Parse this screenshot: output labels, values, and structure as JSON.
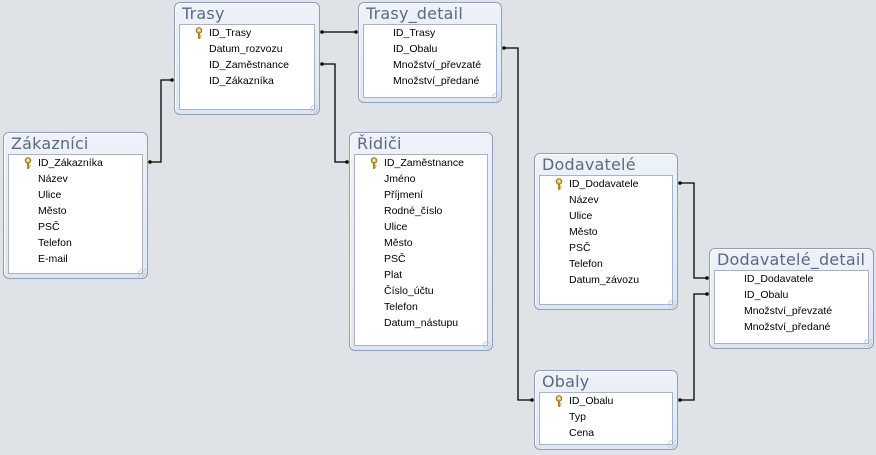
{
  "tables": [
    {
      "id": "trasy",
      "title": "Trasy",
      "fields": [
        {
          "name": "ID_Trasy",
          "key": true
        },
        {
          "name": "Datum_rozvozu",
          "key": false
        },
        {
          "name": "ID_Zaměstnance",
          "key": false
        },
        {
          "name": "ID_Zákazníka",
          "key": false
        }
      ]
    },
    {
      "id": "trasy_detail",
      "title": "Trasy_detail",
      "fields": [
        {
          "name": "ID_Trasy",
          "key": false
        },
        {
          "name": "ID_Obalu",
          "key": false
        },
        {
          "name": "Množství_převzaté",
          "key": false
        },
        {
          "name": "Množství_předané",
          "key": false
        }
      ]
    },
    {
      "id": "zakaznici",
      "title": "Zákazníci",
      "fields": [
        {
          "name": "ID_Zákazníka",
          "key": true
        },
        {
          "name": "Název",
          "key": false
        },
        {
          "name": "Ulice",
          "key": false
        },
        {
          "name": "Město",
          "key": false
        },
        {
          "name": "PSČ",
          "key": false
        },
        {
          "name": "Telefon",
          "key": false
        },
        {
          "name": "E-mail",
          "key": false
        }
      ]
    },
    {
      "id": "ridici",
      "title": "Řidiči",
      "fields": [
        {
          "name": "ID_Zaměstnance",
          "key": true
        },
        {
          "name": "Jméno",
          "key": false
        },
        {
          "name": "Příjmení",
          "key": false
        },
        {
          "name": "Rodné_číslo",
          "key": false
        },
        {
          "name": "Ulice",
          "key": false
        },
        {
          "name": "Město",
          "key": false
        },
        {
          "name": "PSČ",
          "key": false
        },
        {
          "name": "Plat",
          "key": false
        },
        {
          "name": "Číslo_účtu",
          "key": false
        },
        {
          "name": "Telefon",
          "key": false
        },
        {
          "name": "Datum_nástupu",
          "key": false
        }
      ]
    },
    {
      "id": "dodavatele",
      "title": "Dodavatelé",
      "fields": [
        {
          "name": "ID_Dodavatele",
          "key": true
        },
        {
          "name": "Název",
          "key": false
        },
        {
          "name": "Ulice",
          "key": false
        },
        {
          "name": "Město",
          "key": false
        },
        {
          "name": "PSČ",
          "key": false
        },
        {
          "name": "Telefon",
          "key": false
        },
        {
          "name": "Datum_závozu",
          "key": false
        }
      ]
    },
    {
      "id": "dodavatele_detail",
      "title": "Dodavatelé_detail",
      "fields": [
        {
          "name": "ID_Dodavatele",
          "key": false
        },
        {
          "name": "ID_Obalu",
          "key": false
        },
        {
          "name": "Množství_převzaté",
          "key": false
        },
        {
          "name": "Množství_předané",
          "key": false
        }
      ]
    },
    {
      "id": "obaly",
      "title": "Obaly",
      "fields": [
        {
          "name": "ID_Obalu",
          "key": true
        },
        {
          "name": "Typ",
          "key": false
        },
        {
          "name": "Cena",
          "key": false
        }
      ]
    }
  ],
  "relationships": [
    {
      "from": "zakaznici.ID_Zákazníka",
      "to": "trasy.ID_Zákazníka"
    },
    {
      "from": "trasy.ID_Trasy",
      "to": "trasy_detail.ID_Trasy"
    },
    {
      "from": "trasy.ID_Zaměstnance",
      "to": "ridici.ID_Zaměstnance"
    },
    {
      "from": "trasy_detail.ID_Obalu",
      "to": "obaly.ID_Obalu"
    },
    {
      "from": "dodavatele.ID_Dodavatele",
      "to": "dodavatele_detail.ID_Dodavatele"
    },
    {
      "from": "dodavatele_detail.ID_Obalu",
      "to": "obaly.ID_Obalu"
    }
  ],
  "colors": {
    "background": "#dfe3e8",
    "line": "#000000",
    "title_text": "#5a6a82",
    "border": "#8f9fb8"
  },
  "icons": {
    "primary_key": "key-icon"
  }
}
